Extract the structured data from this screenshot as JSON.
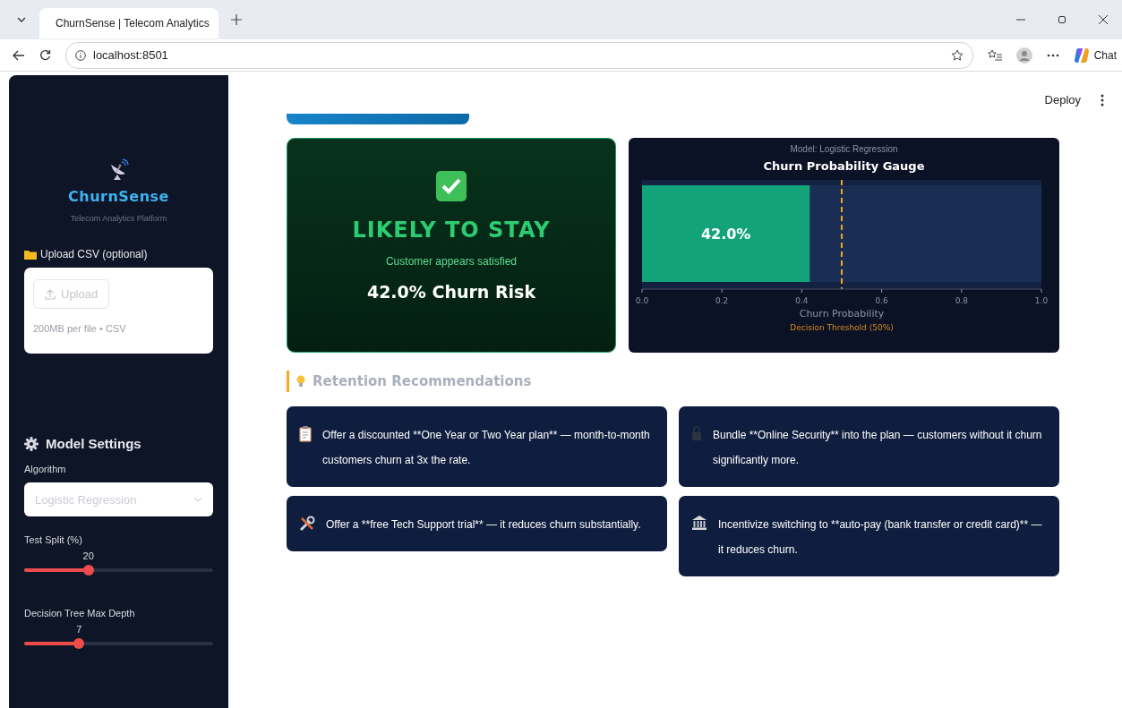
{
  "browser": {
    "tab_title": "ChurnSense | Telecom Analytics",
    "url": "localhost:8501",
    "chat_label": "Chat"
  },
  "toolbar": {
    "deploy": "Deploy"
  },
  "sidebar": {
    "brand": "ChurnSense",
    "tagline": "Telecom Analytics Platform",
    "upload_label": "Upload CSV (optional)",
    "upload_button": "Upload",
    "upload_hint": "200MB per file • CSV",
    "settings_title": "Model Settings",
    "algorithm_label": "Algorithm",
    "algorithm_value": "Logistic Regression",
    "sliders": [
      {
        "label": "Test Split (%)",
        "reading": "20",
        "level": 0.34
      },
      {
        "label": "Decision Tree Max Depth",
        "reading": "7",
        "level": 0.29
      }
    ]
  },
  "prediction": {
    "verdict": "LIKELY TO STAY",
    "subtitle": "Customer appears satisfied",
    "risk": "42.0% Churn Risk"
  },
  "gauge": {
    "model": "Model: Logistic Regression",
    "chart_data": {
      "type": "bar",
      "orientation": "horizontal",
      "title": "Churn Probability Gauge",
      "xlabel": "Churn Probability",
      "values": [
        0.42
      ],
      "value_labels": [
        "42.0%"
      ],
      "xlim": [
        0,
        1
      ],
      "xticks": [
        {
          "value": 0,
          "label": "0.0"
        },
        {
          "value": 0.2,
          "label": "0.2"
        },
        {
          "value": 0.4,
          "label": "0.4"
        },
        {
          "value": 0.6,
          "label": "0.6"
        },
        {
          "value": 0.8,
          "label": "0.8"
        },
        {
          "value": 1,
          "label": "1.0"
        }
      ],
      "ref_lines": [
        {
          "axis": "x",
          "value": 0.5,
          "label": "Decision Threshold (50%)"
        }
      ]
    }
  },
  "recommendations": {
    "heading": "Retention Recommendations",
    "items": [
      {
        "kind": "clipboard",
        "text": "Offer a discounted **One Year or Two Year plan** — month-to-month customers churn at 3x the rate."
      },
      {
        "kind": "lock",
        "text": "Bundle **Online Security** into the plan — customers without it churn significantly more."
      },
      {
        "kind": "tools",
        "text": "Offer a **free Tech Support trial** — it reduces churn substantially."
      },
      {
        "kind": "bank",
        "text": "Incentivize switching to **auto-pay (bank transfer or credit card)** — it reduces churn."
      }
    ]
  }
}
